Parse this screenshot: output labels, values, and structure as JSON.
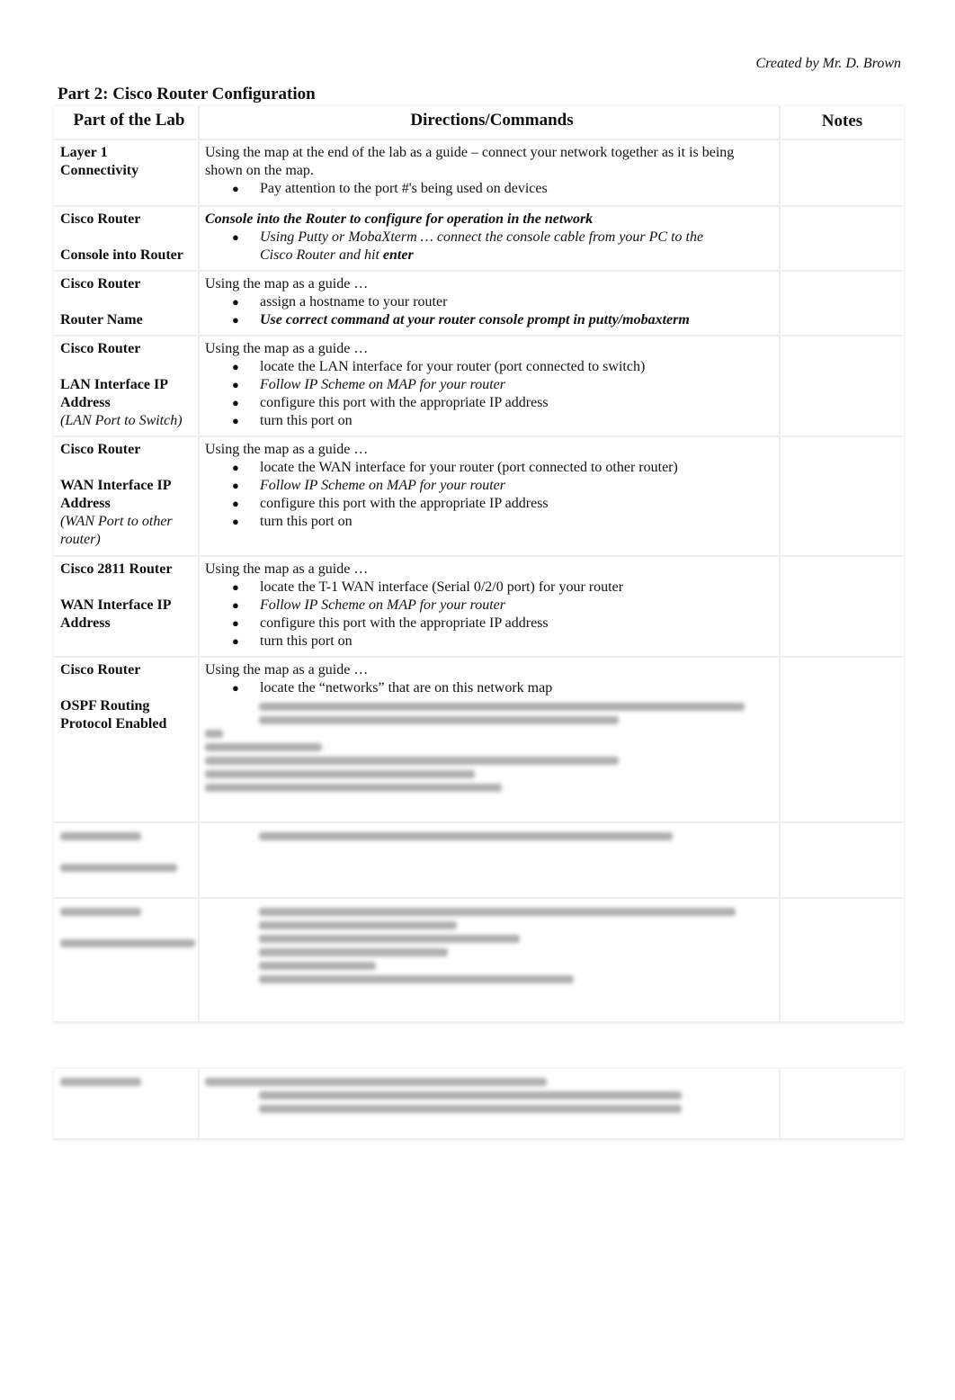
{
  "header": {
    "credit": "Created by Mr. D. Brown",
    "title": "Part 2: Cisco Router Configuration"
  },
  "table": {
    "columns": [
      "Part of the Lab",
      "Directions/Commands",
      "Notes"
    ],
    "rows": [
      {
        "h": 72,
        "label": [
          {
            "t": "Layer 1"
          },
          {
            "t": "Connectivity"
          }
        ],
        "lines": [
          {
            "parts": [
              {
                "t": "Using the map at the end of the lab as a guide – connect your network together as it is being"
              }
            ]
          },
          {
            "parts": [
              {
                "t": "shown on the map."
              }
            ]
          },
          {
            "b": true,
            "parts": [
              {
                "t": "Pay attention to the port #'s being used on devices"
              }
            ]
          }
        ]
      },
      {
        "h": 70,
        "label": [
          {
            "t": "Cisco Router"
          },
          {
            "t": ""
          },
          {
            "t": "Console into Router"
          }
        ],
        "lines": [
          {
            "parts": [
              {
                "t": "  Console into the Router to configure for operation in the network",
                "s": "bi"
              }
            ]
          },
          {
            "b": true,
            "parts": [
              {
                "t": "Using Putty or MobaXterm …  connect the console cable from your PC to the",
                "s": "i"
              }
            ]
          },
          {
            "cont": true,
            "parts": [
              {
                "t": "Cisco Router and hit  ",
                "s": "i"
              },
              {
                "t": "enter",
                "s": "bi"
              }
            ]
          }
        ]
      },
      {
        "h": 70,
        "label": [
          {
            "t": "Cisco Router"
          },
          {
            "t": ""
          },
          {
            "t": "Router Name"
          }
        ],
        "lines": [
          {
            "parts": [
              {
                "t": "Using the map as a guide …"
              }
            ]
          },
          {
            "b": true,
            "parts": [
              {
                "t": "assign a hostname to your router"
              }
            ]
          },
          {
            "b": true,
            "parts": [
              {
                "t": "Use correct command at your router console prompt in putty/mobaxterm",
                "s": "bi"
              }
            ]
          }
        ]
      },
      {
        "h": 110,
        "label": [
          {
            "t": "Cisco Router"
          },
          {
            "t": ""
          },
          {
            "t": "LAN Interface IP"
          },
          {
            "t": "Address"
          },
          {
            "t": "(LAN Port to Switch)",
            "i": true
          }
        ],
        "lines": [
          {
            "parts": [
              {
                "t": "Using the map as a guide …"
              }
            ]
          },
          {
            "b": true,
            "parts": [
              {
                "t": "locate the LAN interface for your router (port connected to switch)"
              }
            ]
          },
          {
            "b": true,
            "parts": [
              {
                "t": "Follow IP Scheme on MAP for your router",
                "s": "i"
              }
            ]
          },
          {
            "b": true,
            "parts": [
              {
                "t": "configure this port with the appropriate IP address"
              }
            ]
          },
          {
            "b": true,
            "parts": [
              {
                "t": "turn this port on"
              }
            ]
          }
        ]
      },
      {
        "h": 131,
        "label": [
          {
            "t": "Cisco Router"
          },
          {
            "t": ""
          },
          {
            "t": "WAN Interface IP"
          },
          {
            "t": "Address"
          },
          {
            "t": "(WAN Port to other",
            "i": true
          },
          {
            "t": "router)",
            "i": true
          }
        ],
        "lines": [
          {
            "parts": [
              {
                "t": "Using the map as a guide …"
              }
            ]
          },
          {
            "b": true,
            "parts": [
              {
                "t": "locate the WAN interface for your router (port connected to other router)"
              }
            ]
          },
          {
            "b": true,
            "parts": [
              {
                "t": "Follow IP Scheme on MAP for your router",
                "s": "i"
              }
            ]
          },
          {
            "b": true,
            "parts": [
              {
                "t": "configure this port with the appropriate IP address"
              }
            ]
          },
          {
            "b": true,
            "parts": [
              {
                "t": "turn this port on"
              }
            ]
          }
        ]
      },
      {
        "h": 110,
        "label": [
          {
            "t": "Cisco 2811 Router"
          },
          {
            "t": ""
          },
          {
            "t": "WAN Interface IP"
          },
          {
            "t": "Address"
          }
        ],
        "lines": [
          {
            "parts": [
              {
                "t": "Using the map as a guide …"
              }
            ]
          },
          {
            "b": true,
            "parts": [
              {
                "t": "locate the T-1 WAN interface (Serial 0/2/0 port) for your router"
              }
            ]
          },
          {
            "b": true,
            "parts": [
              {
                "t": "Follow IP Scheme on MAP for your router",
                "s": "i"
              }
            ]
          },
          {
            "b": true,
            "parts": [
              {
                "t": "configure this port with the appropriate IP address"
              }
            ]
          },
          {
            "b": true,
            "parts": [
              {
                "t": "turn this port on"
              }
            ]
          }
        ]
      },
      {
        "h": 182,
        "label": [
          {
            "t": "Cisco Router"
          },
          {
            "t": ""
          },
          {
            "t": "OSPF Routing"
          },
          {
            "t": "Protocol Enabled"
          }
        ],
        "lines": [
          {
            "parts": [
              {
                "t": "Using the map as a guide …"
              }
            ]
          },
          {
            "b": true,
            "parts": [
              {
                "t": "locate the “networks” that are on this network map"
              }
            ]
          }
        ],
        "blur": [
          [
            60,
            540
          ],
          [
            60,
            400
          ],
          [
            0,
            20
          ],
          [
            0,
            130
          ],
          [
            0,
            460
          ],
          [
            0,
            300
          ],
          [
            0,
            330
          ]
        ]
      },
      {
        "h": 82,
        "blurLabel": [
          90,
          130
        ],
        "blur": [
          [
            60,
            460
          ]
        ]
      },
      {
        "h": 136,
        "blurLabel": [
          90,
          150
        ],
        "blur": [
          [
            60,
            530
          ],
          [
            60,
            220
          ],
          [
            60,
            290
          ],
          [
            60,
            210
          ],
          [
            60,
            130
          ],
          [
            60,
            350
          ]
        ]
      }
    ]
  },
  "table2": {
    "rows": [
      {
        "h": 77,
        "blurLabel": [
          90
        ],
        "blur": [
          [
            0,
            380
          ],
          [
            60,
            470
          ],
          [
            60,
            470
          ]
        ]
      }
    ]
  }
}
